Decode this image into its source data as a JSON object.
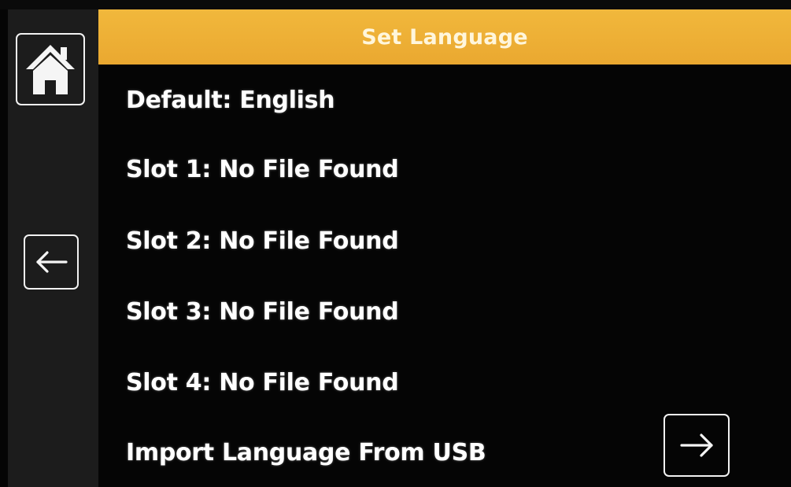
{
  "header": {
    "title": "Set Language"
  },
  "sidebar": {
    "home_icon": "home-icon",
    "back_icon": "arrow-left-icon"
  },
  "languages": [
    {
      "label": "Default: English"
    },
    {
      "label": "Slot 1: No File Found"
    },
    {
      "label": "Slot 2: No File Found"
    },
    {
      "label": "Slot 3: No File Found"
    },
    {
      "label": "Slot 4: No File Found"
    }
  ],
  "import": {
    "label": "Import Language From USB",
    "icon": "arrow-right-icon"
  },
  "colors": {
    "header": "#eaa830",
    "background": "#050505",
    "sidebar": "#1c1c1c",
    "text": "#ffffff"
  }
}
